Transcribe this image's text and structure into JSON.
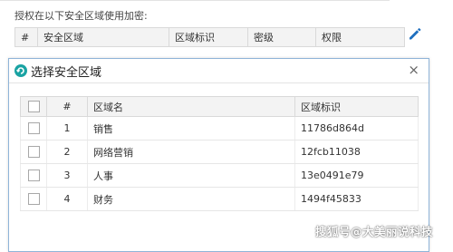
{
  "auth_label": "授权在以下安全区域使用加密:",
  "bg_table": {
    "headers": [
      "#",
      "安全区域",
      "区域标识",
      "密级",
      "权限"
    ]
  },
  "dialog": {
    "title": "选择安全区域",
    "close_label": "×",
    "columns": [
      "#",
      "区域名",
      "区域标识"
    ],
    "rows": [
      {
        "num": "1",
        "name": "销售",
        "id": "11786d864d"
      },
      {
        "num": "2",
        "name": "网络营销",
        "id": "12fcb11038"
      },
      {
        "num": "3",
        "name": "人事",
        "id": "13e0491e79"
      },
      {
        "num": "4",
        "name": "财务",
        "id": "1494f45833"
      }
    ]
  },
  "watermark": "搜狐号@大美丽说科技",
  "colors": {
    "accent": "#2a8fd6",
    "edit_icon": "#1f6fbf",
    "dialog_icon": "#1aa3a3"
  },
  "icons": {
    "edit": "pencil-icon",
    "dialog": "refresh-circle-icon"
  }
}
